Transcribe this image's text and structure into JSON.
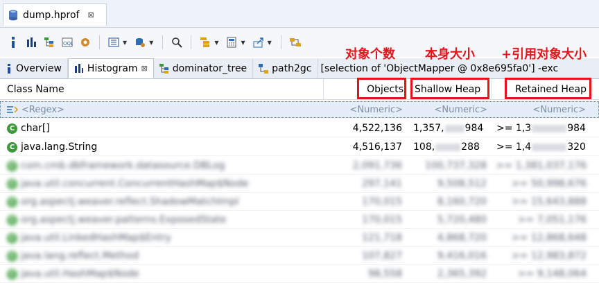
{
  "editor": {
    "tab_title": "dump.hprof",
    "close_glyph": "⊠"
  },
  "toolbar": {
    "items": [
      "overview-info-icon",
      "histogram-icon",
      "dominator-tree-icon",
      "oql-icon",
      "heap-dump-overview-icon",
      "query-browser-icon",
      "run-expert-system-icon",
      "search-icon",
      "group-by-icon",
      "calculate-retained-size-icon",
      "export-icon",
      "pin-icon"
    ]
  },
  "view_tabs": {
    "overview": "Overview",
    "histogram": "Histogram",
    "dominator_tree": "dominator_tree",
    "path2gc": "path2gc",
    "selection": "[selection of 'ObjectMapper @ 0x8e695fa0'] -exc"
  },
  "table": {
    "headers": {
      "class_name": "Class Name",
      "objects": "Objects",
      "shallow_heap": "Shallow Heap",
      "retained_heap": "Retained Heap"
    },
    "filter": {
      "class_name": "<Regex>",
      "objects": "<Numeric>",
      "shallow_heap": "<Numeric>",
      "retained_heap": "<Numeric>"
    },
    "rows": [
      {
        "name": "char[]",
        "objects": "4,522,136",
        "shallow_pre": "1,357,",
        "shallow_post": "984",
        "retained_pre": ">= 1,3",
        "retained_post": "984"
      },
      {
        "name": "java.lang.String",
        "objects": "4,516,137",
        "shallow_pre": "108,",
        "shallow_post": "288",
        "retained_pre": ">= 1,4",
        "retained_post": "320"
      }
    ],
    "blurred_rows": [
      {
        "name": "com.cmb.dbframework.datasource.DBLog",
        "objects": "2,091,736",
        "shallow": "100,737,328",
        "retained": ">= 1,381,037,176"
      },
      {
        "name": "java.util.concurrent.ConcurrentHashMap$Node",
        "objects": "297,141",
        "shallow": "9,508,512",
        "retained": ">= 50,998,676"
      },
      {
        "name": "org.aspectj.weaver.reflect.ShadowMatchImpl",
        "objects": "170,015",
        "shallow": "8,160,720",
        "retained": ">= 15,643,888"
      },
      {
        "name": "org.aspectj.weaver.patterns.ExposedState",
        "objects": "170,015",
        "shallow": "5,720,480",
        "retained": ">= 7,051,176"
      },
      {
        "name": "java.util.LinkedHashMap$Entry",
        "objects": "121,718",
        "shallow": "4,868,720",
        "retained": ">= 12,868,648"
      },
      {
        "name": "java.lang.reflect.Method",
        "objects": "107,827",
        "shallow": "9,416,016",
        "retained": ">= 12,983,872"
      },
      {
        "name": "java.util.HashMap$Node",
        "objects": "98,558",
        "shallow": "2,365,392",
        "retained": ">= 9,148,064"
      }
    ]
  },
  "annotations": {
    "objects": "对象个数",
    "shallow": "本身大小",
    "retained": "+引用对象大小"
  }
}
